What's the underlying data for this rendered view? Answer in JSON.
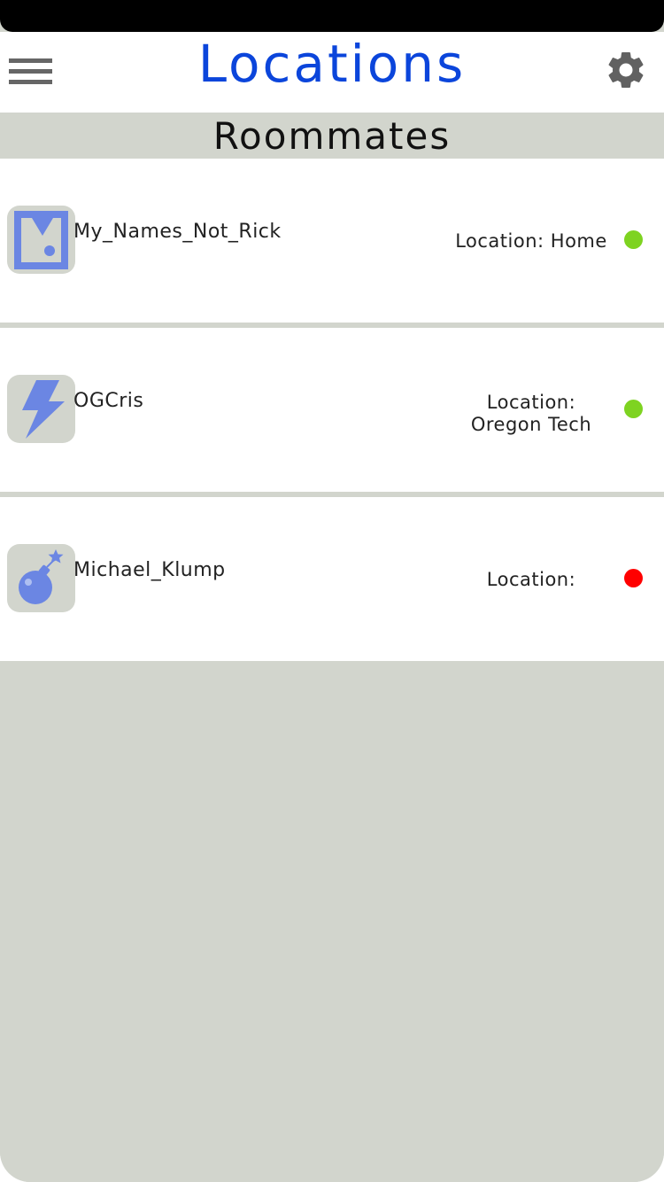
{
  "header": {
    "title": "Locations",
    "menu_icon": "hamburger-menu-icon",
    "settings_icon": "gear-icon"
  },
  "section": {
    "title": "Roommates"
  },
  "roommates": [
    {
      "username": "My_Names_Not_Rick",
      "location": "Location: Home",
      "status_color": "#7ed321",
      "avatar_icon": "picture-frame-icon"
    },
    {
      "username": "OGCris",
      "location": "Location:\nOregon Tech",
      "status_color": "#7ed321",
      "avatar_icon": "lightning-bolt-icon"
    },
    {
      "username": "Michael_Klump",
      "location": "Location:",
      "status_color": "#ff0000",
      "avatar_icon": "bomb-icon"
    }
  ],
  "colors": {
    "title_blue": "#0b45db",
    "icon_blue": "#6b86e3",
    "panel_gray": "#d2d5cd",
    "online_green": "#7ed321",
    "offline_red": "#ff0000"
  }
}
